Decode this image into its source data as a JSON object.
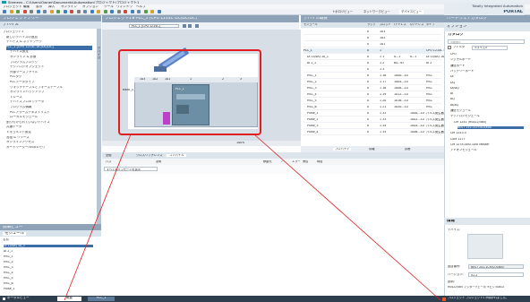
{
  "app": {
    "title": "Siemens - C:\\Users\\Owner\\Documents\\Automation\\プロジェクト\\プロジェクト1",
    "brand": "Totally Integrated Automation",
    "brand_sub": "PORTAL"
  },
  "menu": [
    "プロジェクト",
    "編集",
    "表示",
    "挿入",
    "オンライン",
    "オプション",
    "ツール",
    "ウィンドウ",
    "ヘルプ"
  ],
  "left_panel": {
    "title": "プロジェクトツリー",
    "subtitle": "デバイス",
    "vertical_tab": "デバイス",
    "tree": [
      "プロジェクト1",
      "新しいデバイスの追加",
      "デバイス & ネットワーク",
      "PLC_1 [CPU 1214C DC/DC/DC]",
      "デバイス設定",
      "オンライン & 診断",
      "プログラムブロック",
      "テクノロジオブジェクト",
      "外部ソースファイル",
      "PLCタグ",
      "PLCデータタイプ",
      "ウォッチテーブルとフォーステーブル",
      "オンラインバックアップ",
      "トレース",
      "デバイスプロキシデータ",
      "プログラム情報",
      "PLCアラームテキストリスト",
      "ローカルモジュール",
      "割り付けられていないデバイス",
      "共通データ",
      "ドキュメント設定",
      "言語 & リソース",
      "オンラインアクセス",
      "カードリーダー/USBメモリ"
    ],
    "details_title": "詳細ビュー",
    "details_tab": "モジュール",
    "details_col": "名前",
    "details_rows": [
      "DI 14/DQ 10_1",
      "AI 2_1",
      "HSC_1",
      "HSC_2",
      "HSC_3",
      "HSC_4",
      "HSC_5",
      "HSC_6",
      "Pulse_1"
    ]
  },
  "editor": {
    "breadcrumb": "プロジェクト1 ▸ PLC_1 [CPU 1214C DC/DC/DC]",
    "view_tabs": [
      "トポロジビュー",
      "ネットワークビュー",
      "デバイスビュー"
    ],
    "device_select": "PLC_1 [CPU 1214C]",
    "zoom": "100%",
    "rack_label": "Rack_0",
    "slots": [
      "103",
      "102",
      "101",
      "1",
      "2",
      "3"
    ],
    "plc_label": "PLC_1"
  },
  "overview": {
    "title": "デバイス概要",
    "columns": [
      "モジュール",
      "ラック",
      "スロット",
      "Iアドレス",
      "Qアドレス",
      "タイプ"
    ],
    "rows": [
      [
        "",
        "0",
        "103",
        "",
        "",
        ""
      ],
      [
        "",
        "0",
        "102",
        "",
        "",
        ""
      ],
      [
        "",
        "0",
        "101",
        "",
        "",
        ""
      ],
      [
        "PLC_1",
        "0",
        "1",
        "",
        "",
        "CPU 1214C DC/DC/DC"
      ],
      [
        "DI 14/DQ 10_1",
        "0",
        "1 1",
        "0...1",
        "0...1",
        "DI 14/DQ 10"
      ],
      [
        "AI 2_1",
        "0",
        "1 2",
        "64...67",
        "",
        "AI 2"
      ],
      [
        "",
        "0",
        "1 3",
        "",
        "",
        ""
      ],
      [
        "HSC_1",
        "0",
        "1 16",
        "1000...1003",
        "",
        "HSC"
      ],
      [
        "HSC_2",
        "0",
        "1 17",
        "1004...1007",
        "",
        "HSC"
      ],
      [
        "HSC_3",
        "0",
        "1 18",
        "1008...1011",
        "",
        "HSC"
      ],
      [
        "HSC_4",
        "0",
        "1 19",
        "1012...1015",
        "",
        "HSC"
      ],
      [
        "HSC_5",
        "0",
        "1 20",
        "1016...1019",
        "",
        "HSC"
      ],
      [
        "HSC_6",
        "0",
        "1 21",
        "1020...1023",
        "",
        "HSC"
      ],
      [
        "Pulse_1",
        "0",
        "1 32",
        "",
        "1000...1001",
        "パルス発生器"
      ],
      [
        "Pulse_2",
        "0",
        "1 33",
        "",
        "1002...1003",
        "パルス発生器"
      ],
      [
        "Pulse_3",
        "0",
        "1 34",
        "",
        "1004...1005",
        "パルス発生器"
      ],
      [
        "Pulse_4",
        "0",
        "1 35",
        "",
        "1006...1007",
        "パルス発生器"
      ]
    ]
  },
  "properties": {
    "top_tabs": [
      "プロパティ",
      "情報",
      "診断"
    ],
    "tabs": [
      "全般",
      "クロスリファレンス",
      "コンパイル"
    ],
    "filter_label": "すべてのメッセージを表示",
    "columns": [
      "パス",
      "説明",
      "移動先",
      "?",
      "エラー",
      "警告",
      "時間"
    ]
  },
  "right_panel": {
    "title": "ハードウェアカタログ",
    "options_label": "オプション",
    "catalog_label": "カタログ",
    "search_placeholder": "<検索>",
    "filter_label": "フィルタ",
    "profile": "<すべて>",
    "catalog_items": [
      "CPU",
      "シグナルボード",
      "通信ボード",
      "バッテリーボード",
      "DI",
      "DQ",
      "DI/DQ",
      "AI",
      "AQ",
      "AI/AQ",
      "通信モジュール",
      "テクノロジモジュール",
      "CM 1241 (RS422/485)",
      "6ES7 241-1CH30-0XB0",
      "CM 1243-5",
      "CSM 1277",
      "CM 1278 4xIO-Link Master",
      "アドオンモジュール"
    ],
    "info_title": "情報",
    "info_device_label": "デバイス:",
    "info_device": "CM 1241 (RS422/485)",
    "info_article_label": "品目番号:",
    "info_article": "6ES7 241-1CH32-0XB0",
    "info_version_label": "バージョン:",
    "info_version": "V2.2",
    "info_desc_label": "説明:",
    "info_desc": "RS422/485 インターフェース; 9ピン Sub-D"
  },
  "status": {
    "portal_view": "ポータルビュー",
    "tab1": "概要",
    "tab2": "PLC_1",
    "message": "プロジェクト プロジェクト1 が開かれました。"
  },
  "colors": {
    "header": "#8ea3b7",
    "accent": "#3b6ea6",
    "highlight": "#e02020",
    "module_magenta": "#c03fc8"
  }
}
